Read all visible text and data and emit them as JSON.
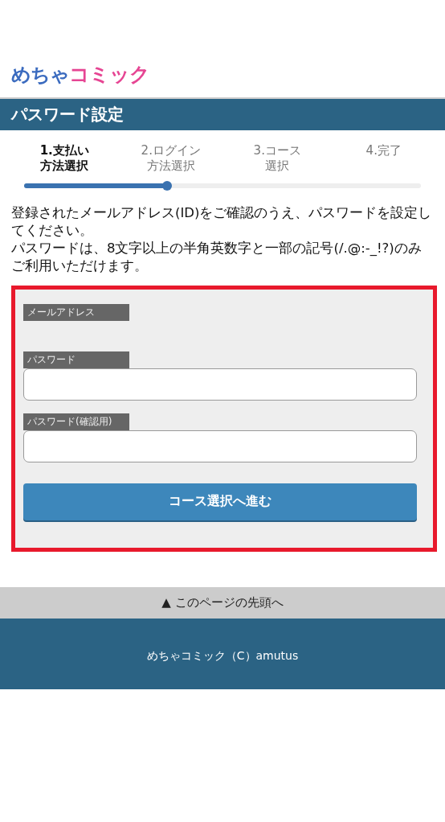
{
  "logo": {
    "part_1": "めちゃ",
    "part_2": "コミック"
  },
  "title": "パスワード設定",
  "steps": [
    {
      "lines": [
        "1.支払い",
        "方法選択"
      ],
      "selected": true
    },
    {
      "lines": [
        "2.ログイン",
        "方法選択"
      ],
      "selected": false
    },
    {
      "lines": [
        "3.コース",
        "選択"
      ],
      "selected": false
    },
    {
      "lines": [
        "4.完了"
      ],
      "selected": false
    }
  ],
  "progress": {
    "level": 0.36
  },
  "intro": [
    "登録されたメールアドレス(ID)をご確認のうえ、パスワードを設定してください。",
    "パスワードは、8文字以上の半角英数字と一部の記号(/.@:-_!?)のみご利用いただけます。"
  ],
  "form": {
    "fields": [
      {
        "label": "メールアドレス",
        "kind": "text"
      },
      {
        "label": "パスワード",
        "kind": "input"
      },
      {
        "label": "パスワード(確認用)",
        "kind": "input"
      }
    ],
    "submit": "コース選択へ進む"
  },
  "page_top": "▲ このページの先頭へ",
  "footer": "めちゃコミック（C）amutus"
}
